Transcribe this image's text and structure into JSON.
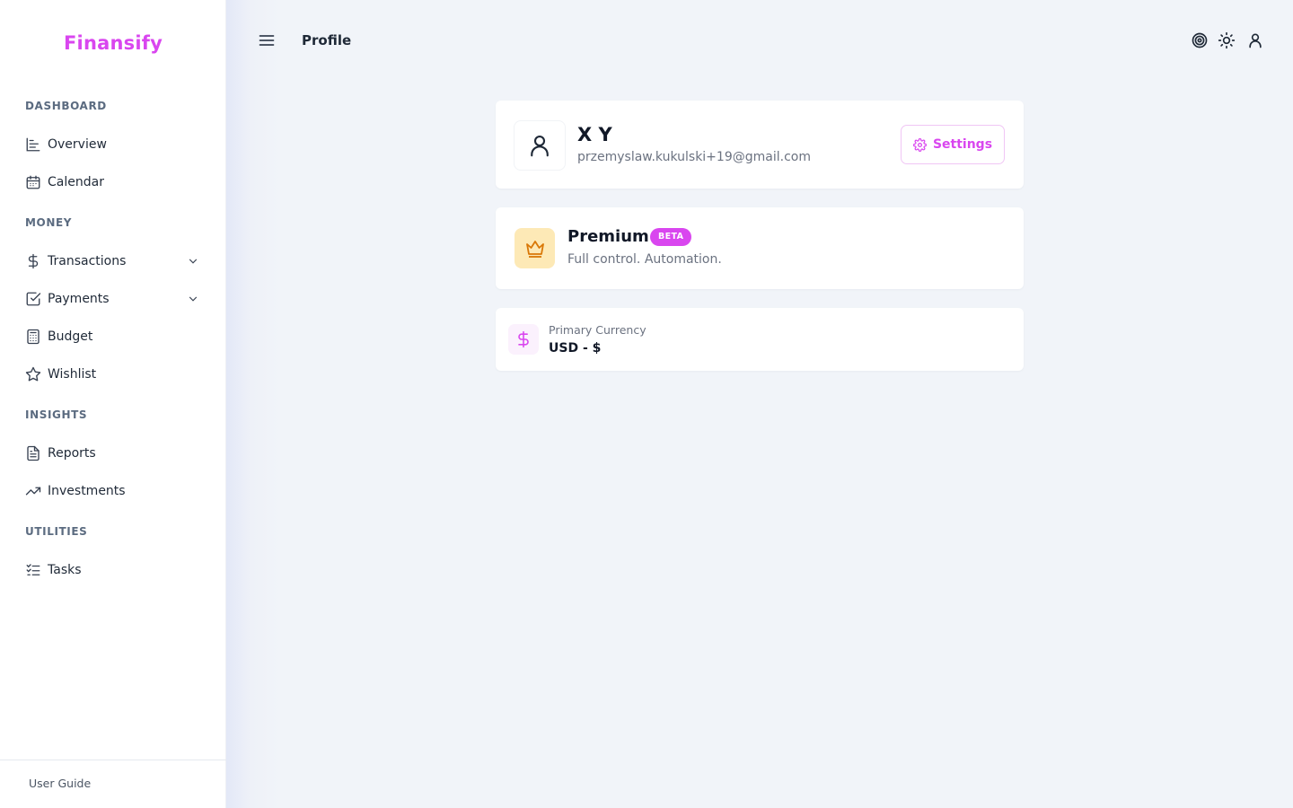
{
  "sidebar": {
    "brand": "Finansify",
    "sections": [
      {
        "title": "DASHBOARD",
        "items": [
          {
            "label": "Overview",
            "icon": "chart-icon"
          },
          {
            "label": "Calendar",
            "icon": "calendar-icon"
          }
        ]
      },
      {
        "title": "MONEY",
        "items": [
          {
            "label": "Transactions",
            "icon": "dollar-icon",
            "expandable": true
          },
          {
            "label": "Payments",
            "icon": "check-square-icon",
            "expandable": true
          },
          {
            "label": "Budget",
            "icon": "calculator-icon"
          },
          {
            "label": "Wishlist",
            "icon": "star-icon"
          }
        ]
      },
      {
        "title": "INSIGHTS",
        "items": [
          {
            "label": "Reports",
            "icon": "file-icon"
          },
          {
            "label": "Investments",
            "icon": "trending-up-icon"
          }
        ]
      },
      {
        "title": "UTILITIES",
        "items": [
          {
            "label": "Tasks",
            "icon": "list-checks-icon"
          }
        ]
      }
    ],
    "footer_link": "User Guide"
  },
  "header": {
    "title": "Profile",
    "icons": [
      "target-icon",
      "sun-icon",
      "user-icon"
    ]
  },
  "profile": {
    "name": "X Y",
    "email": "przemyslaw.kukulski+19@gmail.com",
    "settings_label": "Settings"
  },
  "premium": {
    "title": "Premium",
    "badge": "BETA",
    "subtitle": "Full control. Automation."
  },
  "currency": {
    "label": "Primary Currency",
    "value": "USD - $"
  },
  "colors": {
    "accent": "#d946ef",
    "background": "#f1f4f9",
    "premium_icon_bg": "#fde9b6",
    "premium_icon": "#d97706"
  }
}
